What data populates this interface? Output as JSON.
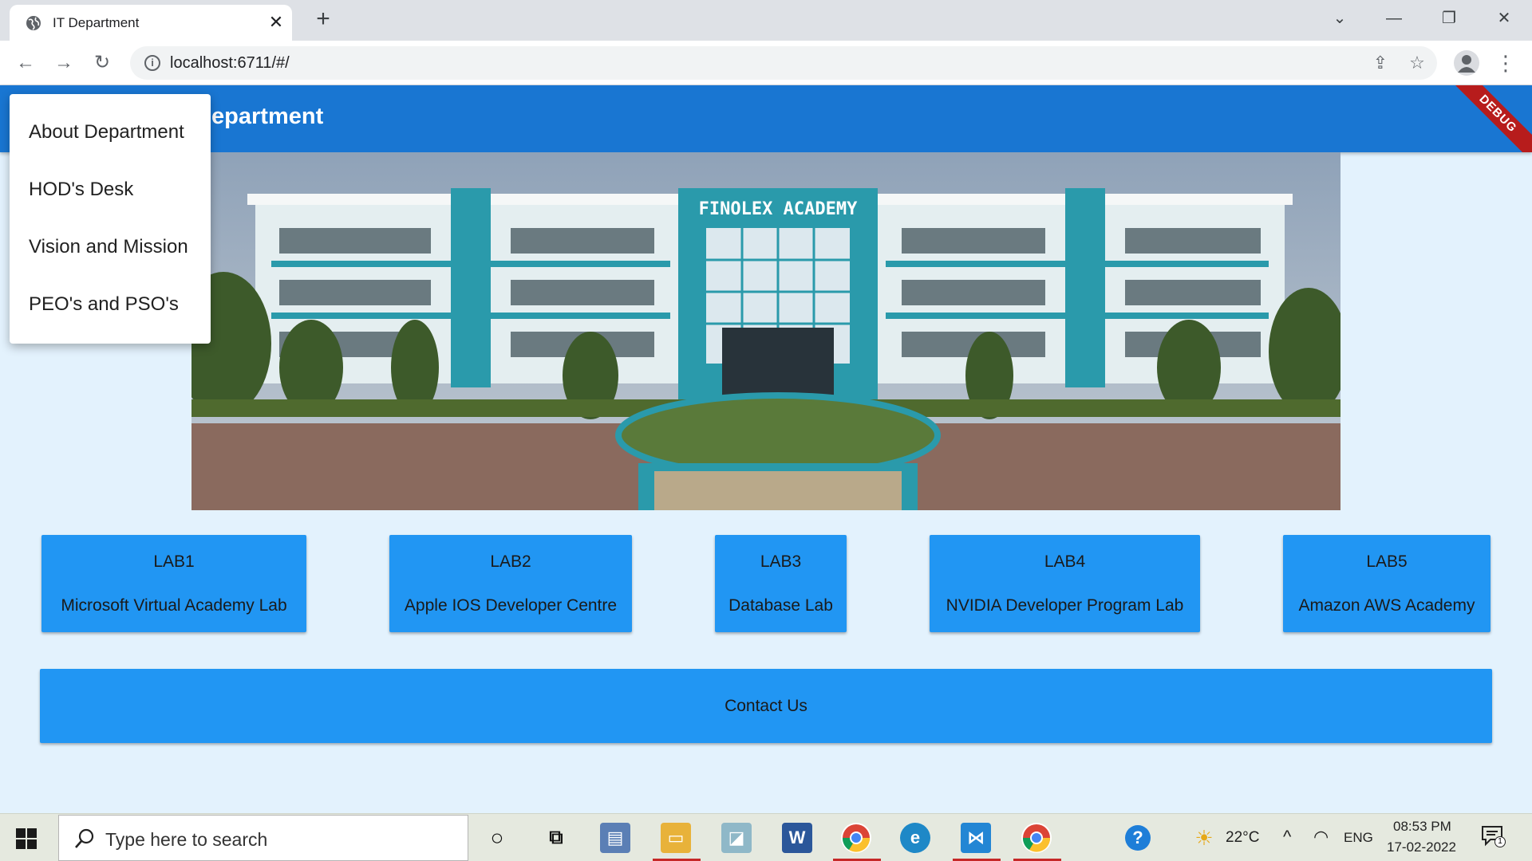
{
  "browser": {
    "tab_title": "IT Department",
    "tab_close": "✕",
    "new_tab": "+",
    "url": "localhost:6711/#/",
    "controls": {
      "tab_search": "⌄",
      "minimize": "—",
      "restore": "❐",
      "close": "✕"
    },
    "nav": {
      "back": "←",
      "forward": "→",
      "reload": "↻"
    },
    "share": "⇪",
    "bookmark": "☆",
    "menu": "⋮"
  },
  "app": {
    "title": "Welcome to IT Department",
    "debug_banner": "DEBUG",
    "hero_sign": "FINOLEX ACADEMY",
    "menu_items": [
      "About Department",
      "HOD's Desk",
      "Vision and Mission",
      "PEO's and PSO's"
    ],
    "labs": [
      {
        "id": "LAB1",
        "name": "Microsoft Virtual Academy Lab"
      },
      {
        "id": "LAB2",
        "name": "Apple IOS Developer Centre"
      },
      {
        "id": "LAB3",
        "name": "Database Lab"
      },
      {
        "id": "LAB4",
        "name": "NVIDIA Developer Program Lab"
      },
      {
        "id": "LAB5",
        "name": "Amazon AWS Academy"
      }
    ],
    "contact_label": "Contact Us"
  },
  "taskbar": {
    "search_placeholder": "Type here to search",
    "temperature": "22°C",
    "language": "ENG",
    "time": "08:53 PM",
    "date": "17-02-2022",
    "notification_count": "1",
    "colors": {
      "accent": "#1976d2",
      "button": "#2196f3"
    }
  }
}
